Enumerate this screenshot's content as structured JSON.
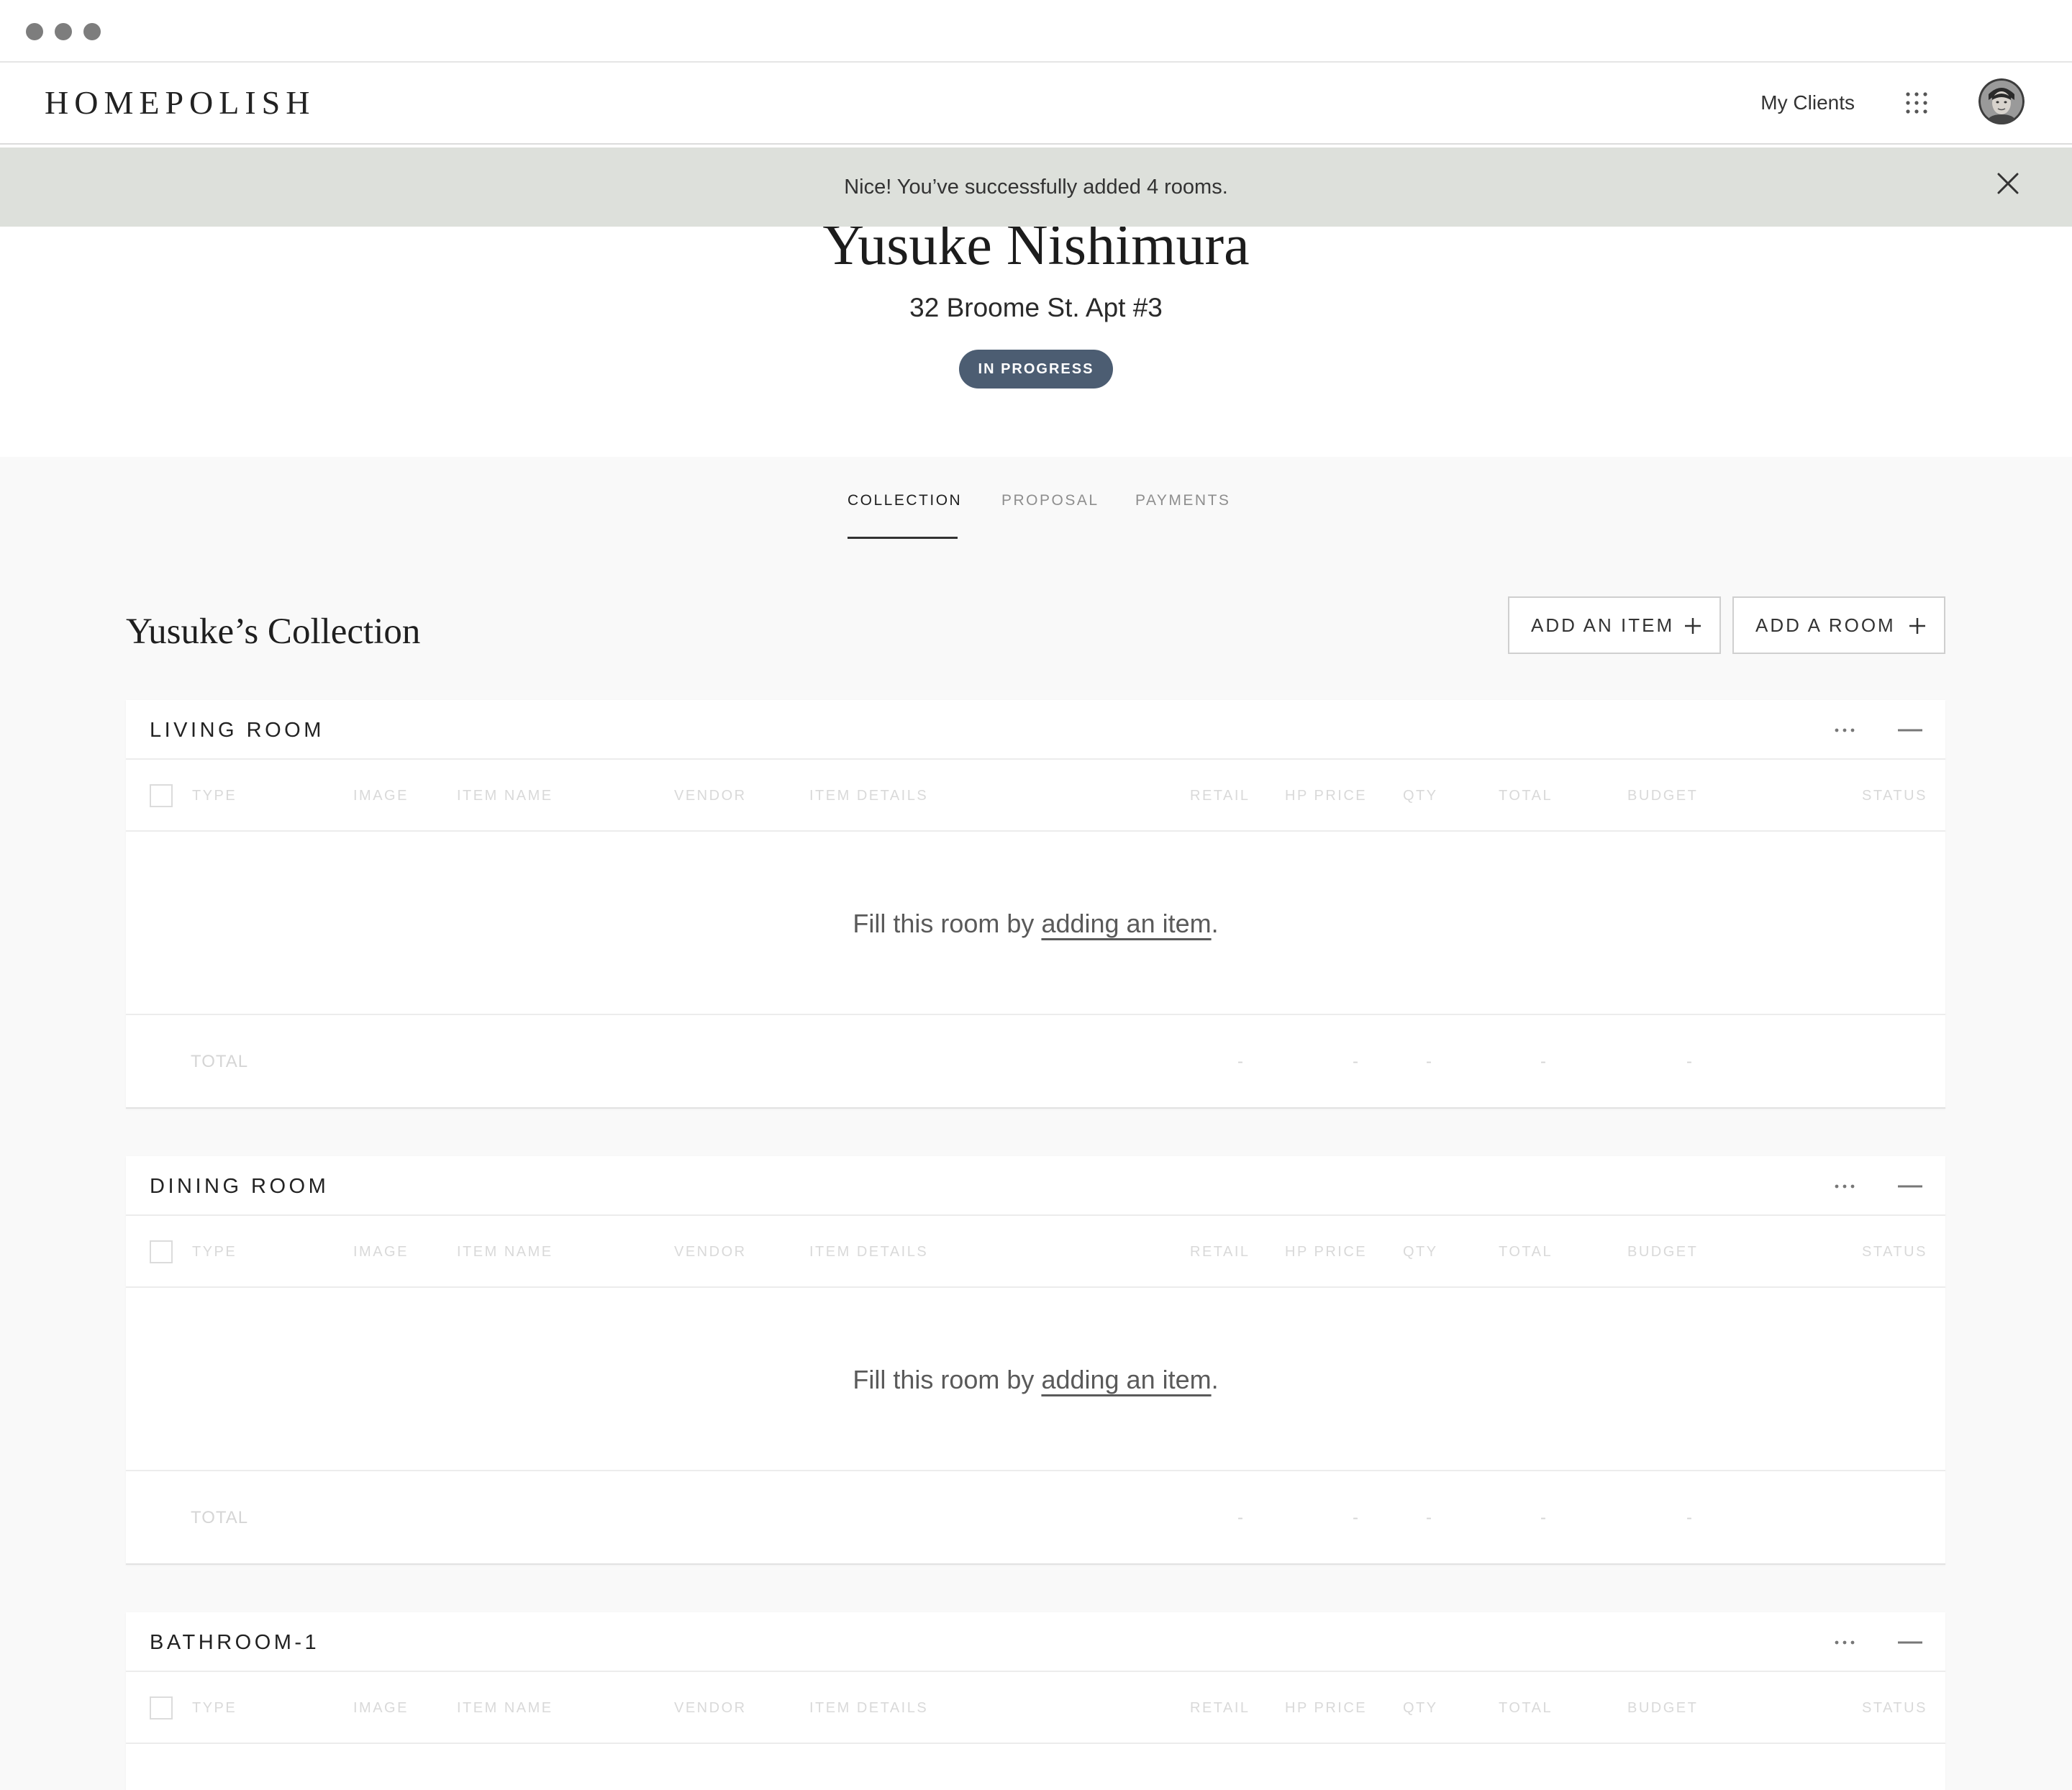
{
  "header": {
    "logo": "HOMEPOLISH",
    "nav_link": "My Clients",
    "apps_icon": "grid-dots-icon",
    "avatar": "user-avatar"
  },
  "toast": {
    "message": "Nice! You’ve successfully added 4 rooms.",
    "close_icon": "close-icon"
  },
  "client": {
    "name": "Yusuke Nishimura",
    "address": "32 Broome St. Apt #3",
    "status": "IN PROGRESS"
  },
  "tabs": [
    {
      "label": "COLLECTION",
      "active": true
    },
    {
      "label": "PROPOSAL",
      "active": false
    },
    {
      "label": "PAYMENTS",
      "active": false
    }
  ],
  "collection": {
    "title": "Yusuke’s Collection",
    "add_item_label": "ADD AN ITEM",
    "add_room_label": "ADD A ROOM"
  },
  "columns": [
    "TYPE",
    "IMAGE",
    "ITEM NAME",
    "VENDOR",
    "ITEM DETAILS",
    "RETAIL",
    "HP PRICE",
    "QTY",
    "TOTAL",
    "BUDGET",
    "STATUS"
  ],
  "empty_state": {
    "prefix": "Fill this room by ",
    "link": "adding an item",
    "suffix": "."
  },
  "total_label": "TOTAL",
  "total_placeholder": "-",
  "rooms": [
    {
      "name": "LIVING ROOM"
    },
    {
      "name": "DINING ROOM"
    },
    {
      "name": "BATHROOM-1"
    }
  ],
  "colors": {
    "toast_bg": "#dde0db",
    "status_pill": "#4c5d72",
    "main_bg": "#f9f9f9"
  }
}
